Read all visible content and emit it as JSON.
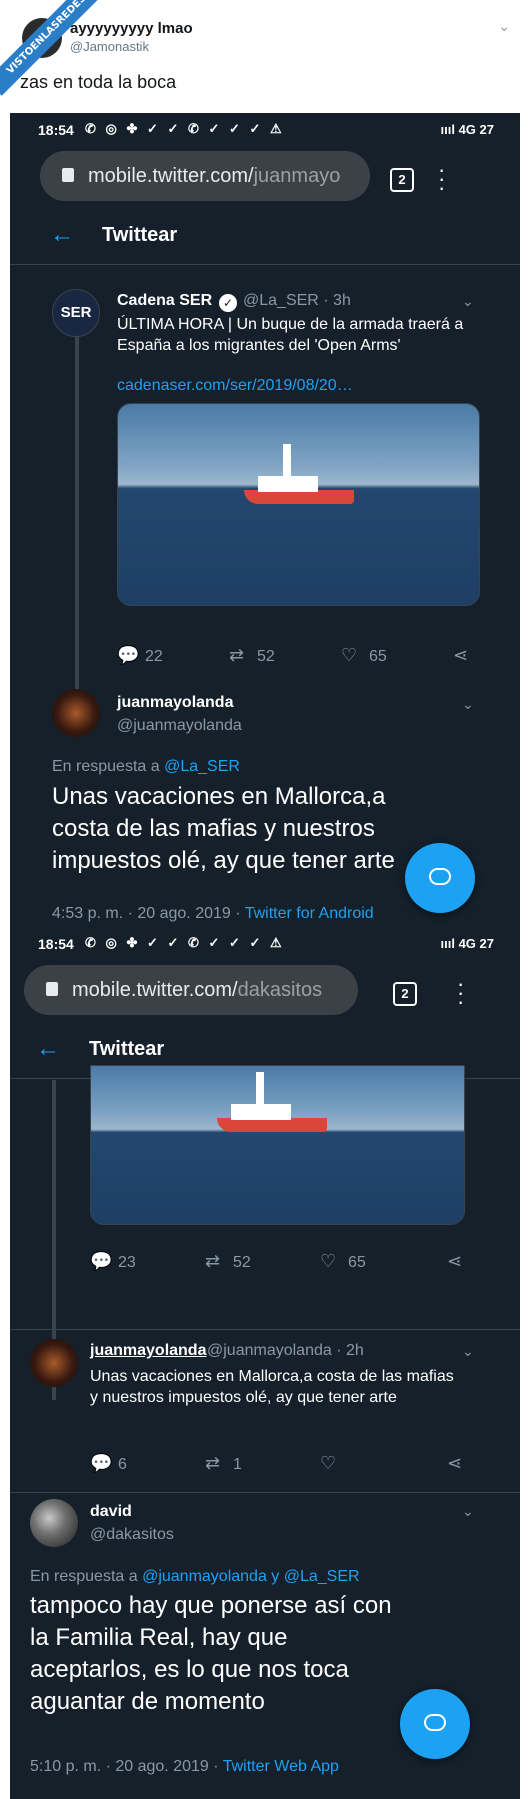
{
  "outer": {
    "banner": "VISTOENLASREDES",
    "username": "ayyyyyyyyy lmao",
    "handle": "@Jamonastik",
    "text": "zas en toda la boca"
  },
  "screens": [
    {
      "status_time": "18:54",
      "status_icons": "✆ ◎ ✤ ✓ ✓ ✆ ✓ ✓ ✓ ⚠",
      "status_right": "ıııl 4G 27",
      "url_domain": "mobile.twitter.com/",
      "url_path": "juanmayo",
      "tab_count": "2",
      "app_title": "Twittear",
      "tweet1": {
        "name": "Cadena SER",
        "handle": "@La_SER · 3h",
        "text": "ÚLTIMA HORA | Un buque de la armada traerá a España a los migrantes del 'Open Arms'",
        "link": "cadenaser.com/ser/2019/08/20…",
        "replies": "22",
        "retweets": "52",
        "likes": "65"
      },
      "tweet2": {
        "name": "juanmayolanda",
        "handle": "@juanmayolanda",
        "reply_prefix": "En respuesta a ",
        "reply_to": "@La_SER",
        "text": "Unas vacaciones en Mallorca,a costa de las mafias y nuestros impuestos olé, ay que tener arte",
        "time": "4:53 p. m. · 20 ago. 2019 · ",
        "source": "Twitter for Android"
      }
    },
    {
      "status_time": "18:54",
      "status_icons": "✆ ◎ ✤ ✓ ✓ ✆ ✓ ✓ ✓ ⚠",
      "status_right": "ıııl 4G 27",
      "url_domain": "mobile.twitter.com/",
      "url_path": "dakasitos",
      "tab_count": "2",
      "app_title": "Twittear",
      "tweet1": {
        "replies": "23",
        "retweets": "52",
        "likes": "65"
      },
      "tweet2": {
        "name": "juanmayolanda",
        "handle": "@juanmayolanda · 2h",
        "text": "Unas vacaciones en Mallorca,a costa de las mafias y nuestros impuestos olé, ay que tener arte",
        "replies": "6",
        "retweets": "1"
      },
      "tweet3": {
        "name": "david",
        "handle": "@dakasitos",
        "reply_prefix": "En respuesta a ",
        "reply_to": "@juanmayolanda y @La_SER",
        "text": "tampoco hay que ponerse así con la Familia Real, hay que aceptarlos, es lo que nos toca aguantar de momento",
        "time": "5:10 p. m. · 20 ago. 2019 · ",
        "source": "Twitter Web App"
      }
    }
  ],
  "colors": {
    "bg": "#15202b",
    "accent": "#1da1f2",
    "muted": "#8899a6"
  },
  "icons": [
    "back-arrow-icon",
    "verified-icon",
    "reply-icon",
    "retweet-icon",
    "like-icon",
    "share-icon",
    "compose-icon",
    "lock-icon",
    "kebab-icon"
  ]
}
